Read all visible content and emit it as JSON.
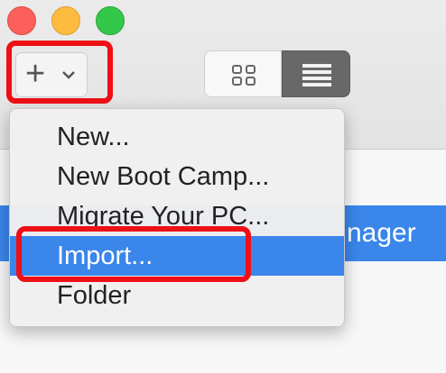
{
  "window": {
    "traffic_lights": [
      "close",
      "minimize",
      "zoom"
    ]
  },
  "toolbar": {
    "add_button_plus": "+",
    "view_modes": [
      "grid",
      "list"
    ],
    "selected_view": "list"
  },
  "list": {
    "selected_row_text": "nager"
  },
  "menu": {
    "items": [
      {
        "label": "New..."
      },
      {
        "label": "New Boot Camp..."
      },
      {
        "label": "Migrate Your PC..."
      },
      {
        "label": "Import..."
      },
      {
        "label": "Folder"
      }
    ],
    "highlighted_index": 3
  },
  "colors": {
    "highlight": "#ef0f16",
    "selection": "#3a86ea"
  }
}
